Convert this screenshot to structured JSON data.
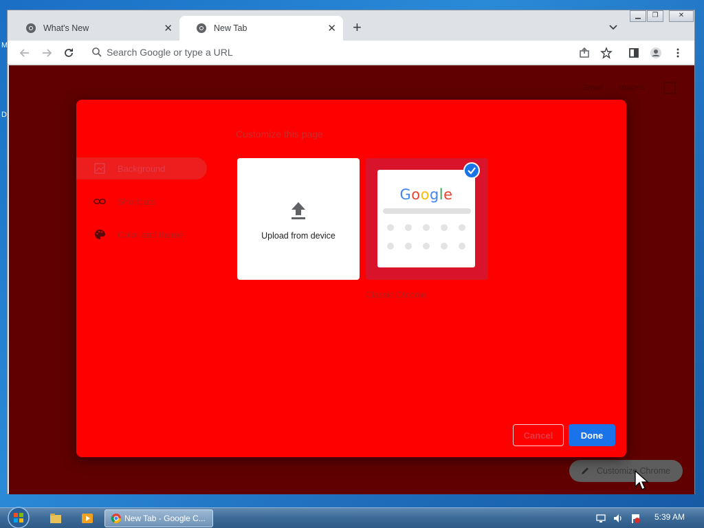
{
  "desktop": {
    "edge_letters": [
      "M",
      "D"
    ]
  },
  "browser": {
    "tabs": [
      {
        "title": "What's New",
        "active": false
      },
      {
        "title": "New Tab",
        "active": true
      }
    ],
    "omnibox_placeholder": "Search Google or type a URL"
  },
  "ntp": {
    "links": [
      "Gmail",
      "Images"
    ],
    "customize_chrome_label": "Customize Chrome"
  },
  "dialog": {
    "title": "Customize this page",
    "nav": [
      {
        "label": "Background",
        "icon": "image-icon",
        "selected": true
      },
      {
        "label": "Shortcuts",
        "icon": "link-icon",
        "selected": false
      },
      {
        "label": "Color and theme",
        "icon": "palette-icon",
        "selected": false
      }
    ],
    "upload_label": "Upload from device",
    "classic_label": "Classic Chrome",
    "google_logo": "Google",
    "cancel_label": "Cancel",
    "done_label": "Done"
  },
  "taskbar": {
    "task_label": "New Tab - Google C...",
    "clock": "5:39 AM"
  },
  "colors": {
    "dialog_bg": "#ff0000",
    "page_bg": "#600000",
    "accent": "#1a73e8"
  }
}
